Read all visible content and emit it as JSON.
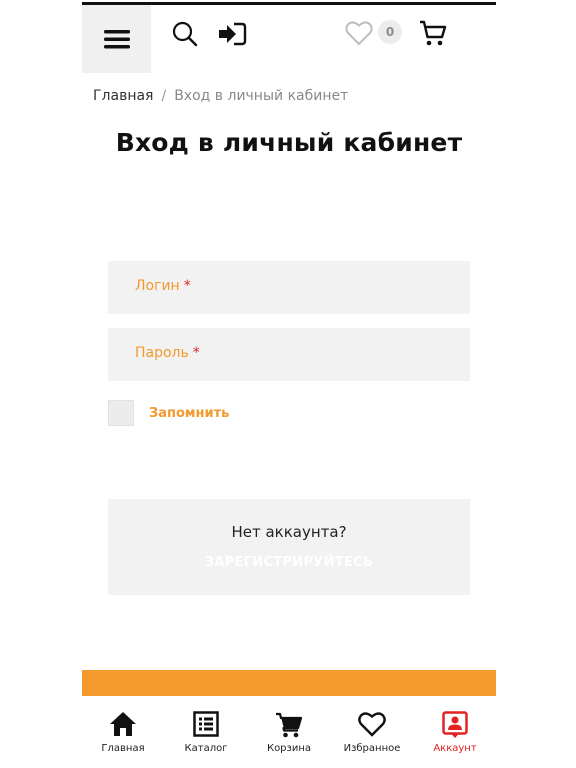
{
  "header": {
    "menu_icon": "hamburger-icon",
    "search_icon": "search-icon",
    "login_icon": "sign-in-icon",
    "favorites_icon": "heart-icon",
    "favorites_count": "0",
    "cart_icon": "cart-icon"
  },
  "breadcrumb": {
    "home": "Главная",
    "separator": "/",
    "current": "Вход в личный кабинет"
  },
  "page": {
    "title": "Вход в личный кабинет"
  },
  "form": {
    "login_label": "Логин",
    "password_label": "Пароль",
    "required_mark": "*",
    "remember_label": "Запомнить",
    "remember_checked": false
  },
  "register": {
    "text": "Нет аккаунта?",
    "link": "ЗАРЕГИСТРИРУЙТЕСЬ"
  },
  "bottom_nav": [
    {
      "label": "Главная",
      "icon": "home-icon"
    },
    {
      "label": "Каталог",
      "icon": "catalog-icon"
    },
    {
      "label": "Корзина",
      "icon": "cart-icon"
    },
    {
      "label": "Избранное",
      "icon": "heart-icon"
    },
    {
      "label": "Аккаунт",
      "icon": "account-icon",
      "active": true
    }
  ],
  "colors": {
    "accent": "#f29a2e",
    "required": "#e32222",
    "active_nav": "#e32222",
    "orange_bar": "#f59a2d"
  }
}
